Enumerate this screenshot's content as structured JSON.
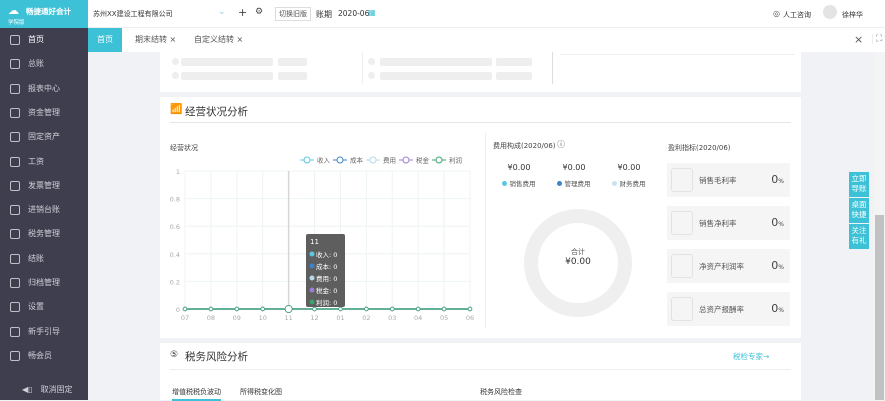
{
  "app": {
    "logo_text": "畅捷通好会计",
    "logo_sub": "学院版",
    "accent": "#3cc1d6"
  },
  "topbar": {
    "company": "苏州XX建设工程有限公司",
    "switch_old": "切换旧版",
    "period_label": "账期",
    "period_value": "2020-06",
    "support": "人工咨询",
    "user": "徐梓华"
  },
  "sidebar": {
    "items": [
      {
        "label": "首页",
        "icon": "home-icon"
      },
      {
        "label": "总账",
        "icon": "ledger-icon"
      },
      {
        "label": "报表中心",
        "icon": "report-icon"
      },
      {
        "label": "资金管理",
        "icon": "fund-icon"
      },
      {
        "label": "固定资产",
        "icon": "asset-icon"
      },
      {
        "label": "工资",
        "icon": "salary-icon"
      },
      {
        "label": "发票管理",
        "icon": "invoice-icon"
      },
      {
        "label": "进销台账",
        "icon": "inventory-icon"
      },
      {
        "label": "税务管理",
        "icon": "tax-icon"
      },
      {
        "label": "结账",
        "icon": "close-books-icon"
      },
      {
        "label": "归档管理",
        "icon": "archive-icon"
      },
      {
        "label": "设置",
        "icon": "gear-icon"
      },
      {
        "label": "新手引导",
        "icon": "guide-icon"
      },
      {
        "label": "畅会员",
        "icon": "vip-icon"
      }
    ],
    "unpin": "取消固定"
  },
  "tabs": [
    {
      "label": "首页",
      "active": true
    },
    {
      "label": "期末结转",
      "closable": true
    },
    {
      "label": "自定义结转",
      "closable": true
    }
  ],
  "business": {
    "title": "经营状况分析",
    "chart_label": "经营状况"
  },
  "chart_data": {
    "type": "line",
    "categories": [
      "07",
      "08",
      "09",
      "10",
      "11",
      "12",
      "01",
      "02",
      "03",
      "04",
      "05",
      "06"
    ],
    "series": [
      {
        "name": "收入",
        "color": "#5bc8e0",
        "values": [
          0,
          0,
          0,
          0,
          0,
          0,
          0,
          0,
          0,
          0,
          0,
          0
        ]
      },
      {
        "name": "成本",
        "color": "#3a86c8",
        "values": [
          0,
          0,
          0,
          0,
          0,
          0,
          0,
          0,
          0,
          0,
          0,
          0
        ]
      },
      {
        "name": "费用",
        "color": "#b8d8ec",
        "values": [
          0,
          0,
          0,
          0,
          0,
          0,
          0,
          0,
          0,
          0,
          0,
          0
        ]
      },
      {
        "name": "税金",
        "color": "#9b7fd4",
        "values": [
          0,
          0,
          0,
          0,
          0,
          0,
          0,
          0,
          0,
          0,
          0,
          0
        ]
      },
      {
        "name": "利润",
        "color": "#3aa56a",
        "values": [
          0,
          0,
          0,
          0,
          0,
          0,
          0,
          0,
          0,
          0,
          0,
          0
        ]
      }
    ],
    "yticks": [
      "0",
      "0.2",
      "0.4",
      "0.6",
      "0.8",
      "1"
    ],
    "ylim": [
      0,
      1
    ],
    "grid": true,
    "legend": "top-right",
    "tooltip": {
      "title": "11",
      "rows": [
        "收入: 0",
        "成本: 0",
        "费用: 0",
        "税金: 0",
        "利润: 0"
      ]
    }
  },
  "expense": {
    "title": "费用构成(2020/06)",
    "items": [
      {
        "value": "¥0.00",
        "label": "销售费用",
        "color": "#5bc8e0"
      },
      {
        "value": "¥0.00",
        "label": "管理费用",
        "color": "#3a86c8"
      },
      {
        "value": "¥0.00",
        "label": "财务费用",
        "color": "#c5e3f0"
      }
    ],
    "total_label": "合计",
    "total_value": "¥0.00"
  },
  "profit": {
    "title": "盈利指标(2020/06)",
    "items": [
      {
        "label": "销售毛利率",
        "value": "0",
        "unit": "%"
      },
      {
        "label": "销售净利率",
        "value": "0",
        "unit": "%"
      },
      {
        "label": "净资产利润率",
        "value": "0",
        "unit": "%"
      },
      {
        "label": "总资产报酬率",
        "value": "0",
        "unit": "%"
      }
    ]
  },
  "tax": {
    "title": "税务风险分析",
    "expert_link": "税检专家→",
    "tabs": [
      "增值税税负波动",
      "所得税变化图"
    ],
    "right_title": "税务风险检查"
  },
  "float_buttons": [
    "立即导账",
    "桌面快捷",
    "关注有礼"
  ]
}
